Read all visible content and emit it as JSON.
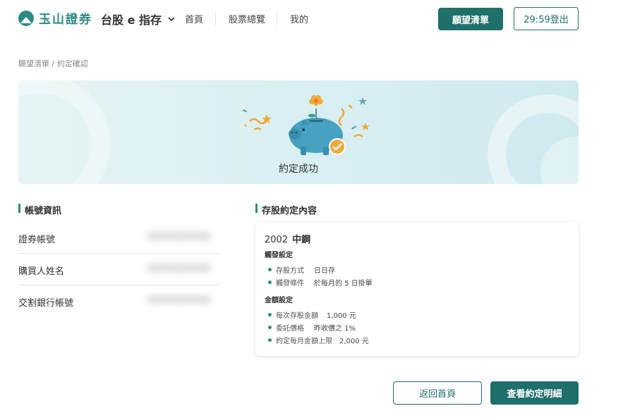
{
  "header": {
    "logo_text": "玉山證券",
    "product": "台股 e 指存",
    "nav": [
      "首頁",
      "股票總覽",
      "我的"
    ],
    "wishlist_button": "願望清單",
    "logout_button": "29:59登出"
  },
  "breadcrumb": "願望清單 / 約定確認",
  "banner": {
    "title": "約定成功",
    "accent_color": "#2e8b83"
  },
  "account": {
    "section_title": "帳號資訊",
    "rows": [
      {
        "label": "證券帳號",
        "value": "XXXXXXXXXX"
      },
      {
        "label": "購買人姓名",
        "value": "XXXXXXXXXX"
      },
      {
        "label": "交割銀行帳號",
        "value": "XXXXXXXXXX"
      }
    ]
  },
  "agreement": {
    "section_title": "存股約定內容",
    "stock_code": "2002",
    "stock_name": "中鋼",
    "trigger": {
      "title": "觸發設定",
      "items": [
        {
          "key": "存股方式",
          "value": "日日存"
        },
        {
          "key": "觸發條件",
          "value": "於每月的 5 日掛單"
        }
      ]
    },
    "amount": {
      "title": "金額設定",
      "items": [
        {
          "key": "每次存股金額",
          "value": "1,000 元"
        },
        {
          "key": "委託價格",
          "value": "昨收價之 1%"
        },
        {
          "key": "約定每月金額上限",
          "value": "2,000 元"
        }
      ]
    }
  },
  "actions": {
    "back_home": "返回首頁",
    "view_detail": "查看約定明細"
  },
  "colors": {
    "primary": "#1f6f6b",
    "brand": "#2e8b83",
    "banner_bg": "#d9eff2"
  }
}
